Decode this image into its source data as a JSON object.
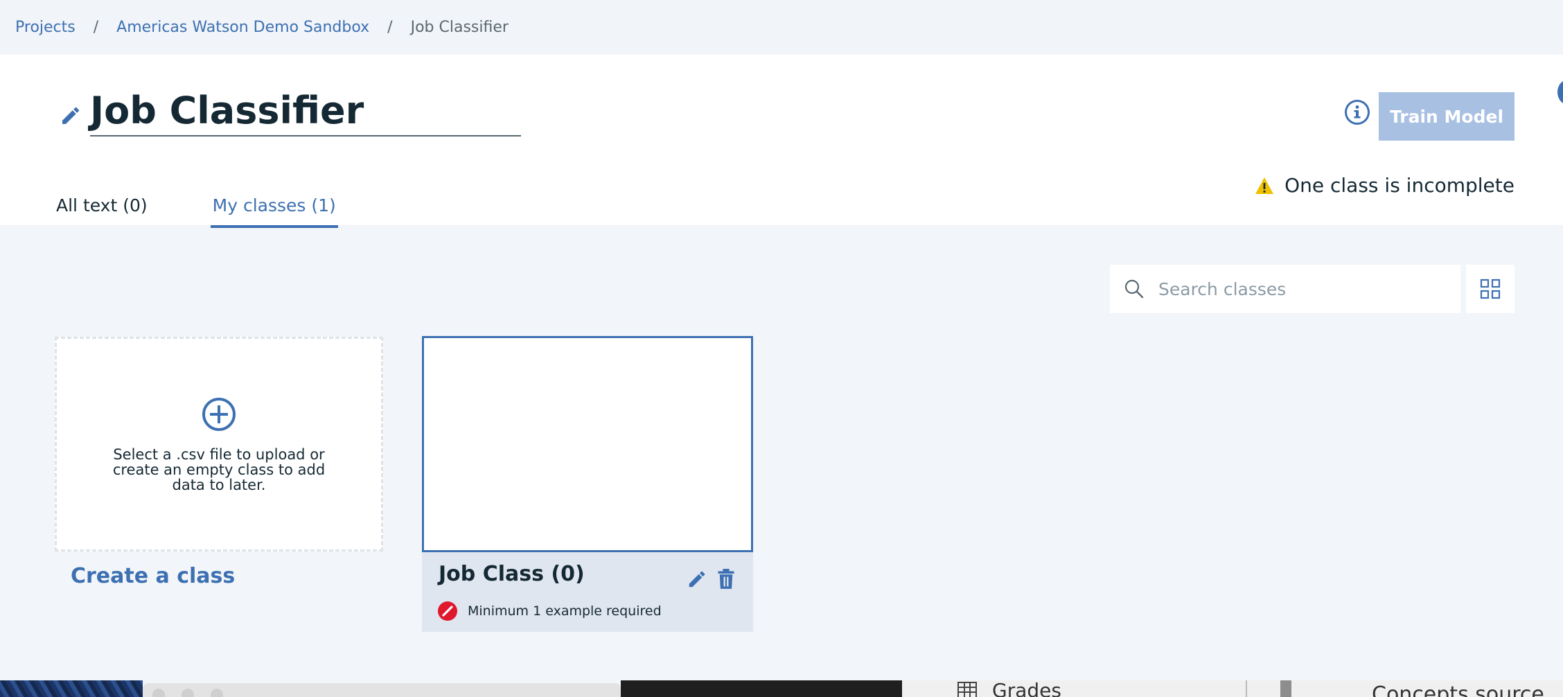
{
  "breadcrumb": {
    "items": [
      "Projects",
      "Americas Watson Demo Sandbox"
    ],
    "separator": "/",
    "current": "Job Classifier"
  },
  "header": {
    "title": "Job Classifier",
    "train_button": "Train Model",
    "warning": "One class is incomplete",
    "tabs": [
      {
        "label": "All text (0)",
        "active": false
      },
      {
        "label": "My classes (1)",
        "active": true
      }
    ]
  },
  "toolbar": {
    "search_placeholder": "Search classes",
    "view_icon": "grid-view-icon"
  },
  "create_card": {
    "description": "Select a .csv file to upload or create an empty class to add data to later.",
    "link": "Create a class"
  },
  "classes": [
    {
      "name": "Job Class (0)",
      "status": "Minimum 1 example required"
    }
  ],
  "desktop": {
    "finder_item": "Grades",
    "partial_text": "Concepts source"
  },
  "colors": {
    "accent": "#3d70b2",
    "train_disabled": "#a8c0e2",
    "warning": "#efc100",
    "error": "#e0182d",
    "page_bg": "#f2f5f9"
  }
}
